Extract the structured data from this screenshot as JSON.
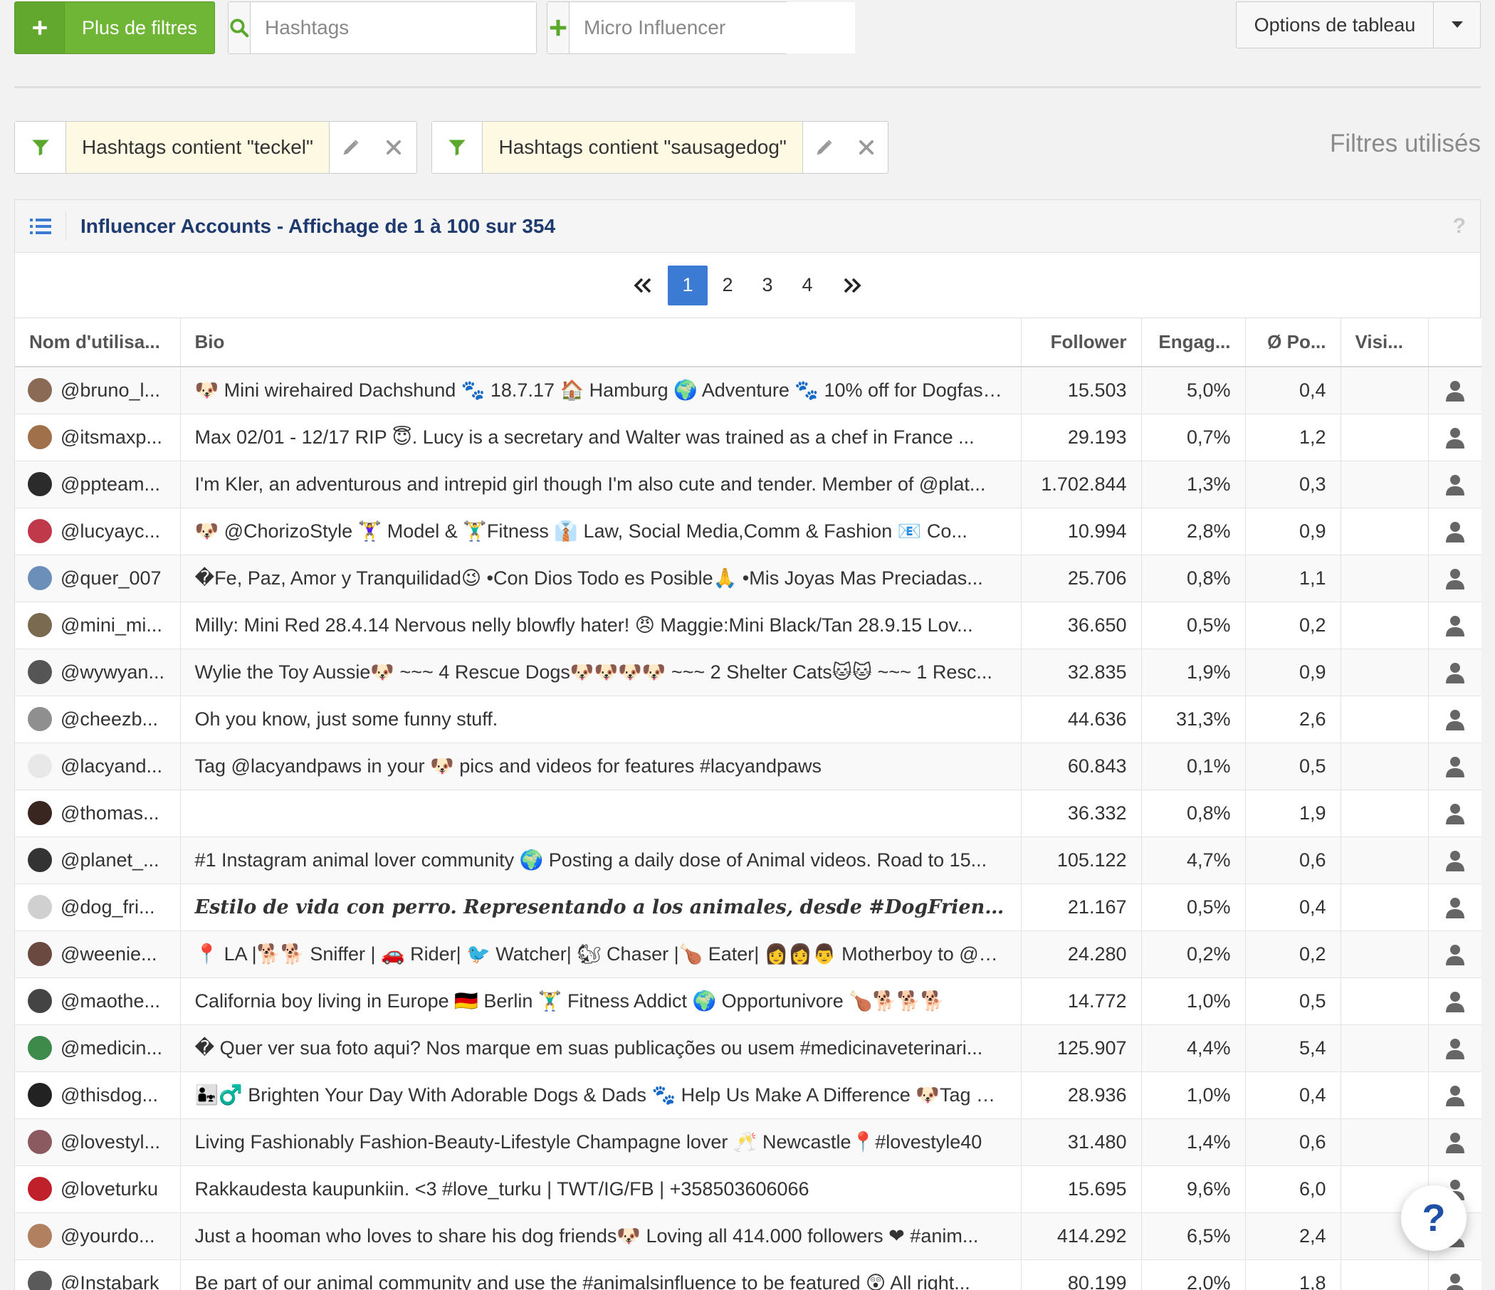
{
  "toolbar": {
    "more_filters_label": "Plus de filtres",
    "hashtags_placeholder": "Hashtags",
    "micro_placeholder": "Micro Influencer",
    "table_options_label": "Options de tableau"
  },
  "filters": {
    "chips": [
      {
        "text": "Hashtags contient \"teckel\""
      },
      {
        "text": "Hashtags contient \"sausagedog\""
      }
    ],
    "used_label": "Filtres utilisés"
  },
  "panel": {
    "title": "Influencer Accounts - Affichage de 1 à 100 sur 354",
    "help": "?"
  },
  "pagination": {
    "pages": [
      "1",
      "2",
      "3",
      "4"
    ],
    "current": "1"
  },
  "table": {
    "columns": {
      "username": "Nom d'utilisa...",
      "bio": "Bio",
      "follower": "Follower",
      "engagement": "Engag...",
      "posts": "Ø Po...",
      "visits": "Visi..."
    },
    "rows": [
      {
        "username": "@bruno_l...",
        "bio": "🐶 Mini wirehaired Dachshund 🐾 18.7.17 🏠 Hamburg 🌍 Adventure 🐾 10% off for Dogfash...",
        "follower": "15.503",
        "engagement": "5,0%",
        "posts": "0,4",
        "avatar": "#8a6a55"
      },
      {
        "username": "@itsmaxp...",
        "bio": "Max 02/01 - 12/17 RIP 😇. Lucy is a secretary and Walter was trained as a chef in France ...",
        "follower": "29.193",
        "engagement": "0,7%",
        "posts": "1,2",
        "avatar": "#a0704a"
      },
      {
        "username": "@ppteam...",
        "bio": "I'm Kler, an adventurous and intrepid girl though I'm also cute and tender. Member of @plat...",
        "follower": "1.702.844",
        "engagement": "1,3%",
        "posts": "0,3",
        "avatar": "#2b2b2b"
      },
      {
        "username": "@lucyayc...",
        "bio": "🐶 @ChorizoStyle 🏋️‍♀️ Model & 🏋️‍♂️Fitness 👔 Law, Social Media,Comm & Fashion 📧 Co...",
        "follower": "10.994",
        "engagement": "2,8%",
        "posts": "0,9",
        "avatar": "#c0394a"
      },
      {
        "username": "@quer_007",
        "bio": "�Fe, Paz, Amor y Tranquilidad😉 •Con Dios Todo es Posible🙏 •Mis Joyas Mas Preciadas...",
        "follower": "25.706",
        "engagement": "0,8%",
        "posts": "1,1",
        "avatar": "#6b8fb8"
      },
      {
        "username": "@mini_mi...",
        "bio": "Milly: Mini Red 28.4.14 Nervous nelly blowfly hater! 😠 Maggie:Mini Black/Tan 28.9.15 Lov...",
        "follower": "36.650",
        "engagement": "0,5%",
        "posts": "0,2",
        "avatar": "#7a6a50"
      },
      {
        "username": "@wywyan...",
        "bio": "Wylie the Toy Aussie🐶 ~~~ 4 Rescue Dogs🐶🐶🐶🐶 ~~~ 2 Shelter Cats🐱🐱 ~~~ 1 Resc...",
        "follower": "32.835",
        "engagement": "1,9%",
        "posts": "0,9",
        "avatar": "#555555"
      },
      {
        "username": "@cheezb...",
        "bio": "Oh you know, just some funny stuff.",
        "follower": "44.636",
        "engagement": "31,3%",
        "posts": "2,6",
        "avatar": "#8f8f8f"
      },
      {
        "username": "@lacyand...",
        "bio": "Tag @lacyandpaws in your 🐶 pics and videos for features #lacyandpaws",
        "follower": "60.843",
        "engagement": "0,1%",
        "posts": "0,5",
        "avatar": "#e8e8e8"
      },
      {
        "username": "@thomas...",
        "bio": "",
        "follower": "36.332",
        "engagement": "0,8%",
        "posts": "1,9",
        "avatar": "#3a2620"
      },
      {
        "username": "@planet_...",
        "bio": "#1 Instagram animal lover community 🌍 Posting a daily dose of Animal videos. Road to 15...",
        "follower": "105.122",
        "engagement": "4,7%",
        "posts": "0,6",
        "avatar": "#333333"
      },
      {
        "username": "@dog_fri...",
        "bio": "Estilo de vida con perro. Representando a los animales, desde #DogFriendlyTravele...",
        "follower": "21.167",
        "engagement": "0,5%",
        "posts": "0,4",
        "avatar": "#d0d0d0",
        "serif": true
      },
      {
        "username": "@weenie...",
        "bio": "📍 LA |🐕🐕 Sniffer | 🚗 Rider| 🐦 Watcher| 🐿 Chaser |🍗 Eater| 👩👩👨 Motherboy to @deema...",
        "follower": "24.280",
        "engagement": "0,2%",
        "posts": "0,2",
        "avatar": "#6a4a40"
      },
      {
        "username": "@maothe...",
        "bio": "California boy living in Europe 🇩🇪 Berlin 🏋️‍♂️ Fitness Addict 🌍 Opportunivore 🍗🐕🐕🐕",
        "follower": "14.772",
        "engagement": "1,0%",
        "posts": "0,5",
        "avatar": "#444444"
      },
      {
        "username": "@medicin...",
        "bio": "� Quer ver sua foto aqui? Nos marque em suas publicações ou usem #medicinaveterinari...",
        "follower": "125.907",
        "engagement": "4,4%",
        "posts": "5,4",
        "avatar": "#3d8a4a"
      },
      {
        "username": "@thisdog...",
        "bio": "👨‍👧‍♂️ Brighten Your Day With Adorable Dogs & Dads 🐾 Help Us Make A Difference 🐶Tag & F...",
        "follower": "28.936",
        "engagement": "1,0%",
        "posts": "0,4",
        "avatar": "#222222"
      },
      {
        "username": "@lovestyl...",
        "bio": "Living Fashionably Fashion-Beauty-Lifestyle Champagne lover 🥂 Newcastle📍#lovestyle40",
        "follower": "31.480",
        "engagement": "1,4%",
        "posts": "0,6",
        "avatar": "#8a5a60"
      },
      {
        "username": "@loveturku",
        "bio": "Rakkaudesta kaupunkiin. <3 #love_turku | TWT/IG/FB | +358503606066",
        "follower": "15.695",
        "engagement": "9,6%",
        "posts": "6,0",
        "avatar": "#c0202a"
      },
      {
        "username": "@yourdo...",
        "bio": "Just a hooman who loves to share his dog friends🐶 Loving all 414.000 followers ❤ #anim...",
        "follower": "414.292",
        "engagement": "6,5%",
        "posts": "2,4",
        "avatar": "#b08060"
      },
      {
        "username": "@Instabark",
        "bio": "Be part of our animal community and use the #animalsinfluence to be featured 😲 All right...",
        "follower": "80.199",
        "engagement": "2,0%",
        "posts": "1,8",
        "avatar": "#5a5a5a"
      }
    ]
  },
  "fab": {
    "label": "?"
  },
  "colors": {
    "green": "#6fb536",
    "accent_blue": "#3c7bd4",
    "title_navy": "#1e3a6e"
  }
}
